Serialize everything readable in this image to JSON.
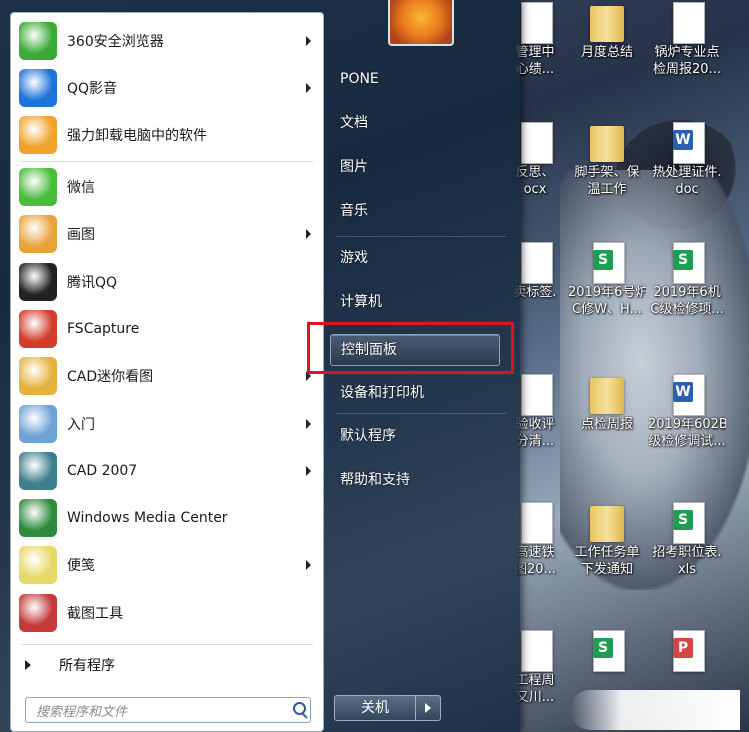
{
  "desktop": {
    "icons": [
      {
        "type": "doc",
        "badge": "",
        "line1": "管理中",
        "line2": "心绩..."
      },
      {
        "type": "folder",
        "badge": "",
        "line1": "月度总结",
        "line2": ""
      },
      {
        "type": "doc",
        "badge": "",
        "line1": "锅炉专业点",
        "line2": "检周报20..."
      },
      {
        "type": "doc",
        "badge": "",
        "line1": "反思、",
        "line2": "ocx"
      },
      {
        "type": "folder",
        "badge": "",
        "line1": "脚手架、保",
        "line2": "温工作"
      },
      {
        "type": "doc",
        "badge": "W",
        "line1": "热处理证件.",
        "line2": "doc"
      },
      {
        "type": "doc",
        "badge": "",
        "line1": "卖标签.",
        "line2": ""
      },
      {
        "type": "doc",
        "badge": "S",
        "line1": "2019年6号炉",
        "line2": "C修W、H..."
      },
      {
        "type": "doc",
        "badge": "S",
        "line1": "2019年6机",
        "line2": "C级检修项..."
      },
      {
        "type": "doc",
        "badge": "",
        "line1": "验收评",
        "line2": "分清..."
      },
      {
        "type": "folder",
        "badge": "",
        "line1": "点检周报",
        "line2": ""
      },
      {
        "type": "doc",
        "badge": "W",
        "line1": "2019年602B",
        "line2": "级检修调试..."
      },
      {
        "type": "doc",
        "badge": "",
        "line1": "高速铁",
        "line2": "图20..."
      },
      {
        "type": "folder",
        "badge": "",
        "line1": "工作任务单",
        "line2": "下发通知"
      },
      {
        "type": "doc",
        "badge": "S",
        "line1": "招考职位表.",
        "line2": "xls"
      },
      {
        "type": "doc",
        "badge": "",
        "line1": "工程周",
        "line2": "又川..."
      },
      {
        "type": "doc",
        "badge": "S",
        "line1": "",
        "line2": ""
      },
      {
        "type": "doc",
        "badge": "P",
        "line1": "",
        "line2": ""
      }
    ]
  },
  "start_menu": {
    "pinned": [
      {
        "name": "360安全浏览器",
        "icon": "360-browser-icon",
        "arrow": true
      },
      {
        "name": "QQ影音",
        "icon": "qq-player-icon",
        "arrow": true
      },
      {
        "name": "强力卸载电脑中的软件",
        "icon": "uninstaller-icon",
        "arrow": false
      }
    ],
    "recent": [
      {
        "name": "微信",
        "icon": "wechat-icon",
        "arrow": false
      },
      {
        "name": "画图",
        "icon": "paint-icon",
        "arrow": true
      },
      {
        "name": "腾讯QQ",
        "icon": "qq-penguin-icon",
        "arrow": false
      },
      {
        "name": "FSCapture",
        "icon": "fscapture-icon",
        "arrow": false
      },
      {
        "name": "CAD迷你看图",
        "icon": "cad-viewer-icon",
        "arrow": true
      },
      {
        "name": "入门",
        "icon": "getting-started-icon",
        "arrow": true
      },
      {
        "name": "CAD 2007",
        "icon": "autocad-icon",
        "arrow": true
      },
      {
        "name": "Windows Media Center",
        "icon": "media-center-icon",
        "arrow": false
      },
      {
        "name": "便笺",
        "icon": "sticky-notes-icon",
        "arrow": true
      },
      {
        "name": "截图工具",
        "icon": "snipping-tool-icon",
        "arrow": false
      }
    ],
    "all_programs": "所有程序",
    "search_placeholder": "搜索程序和文件",
    "right_items": [
      {
        "label": "PONE"
      },
      {
        "label": "文档"
      },
      {
        "label": "图片"
      },
      {
        "label": "音乐"
      },
      {
        "label": "游戏"
      },
      {
        "label": "计算机"
      },
      {
        "label": "控制面板"
      },
      {
        "label": "设备和打印机"
      },
      {
        "label": "默认程序"
      },
      {
        "label": "帮助和支持"
      }
    ],
    "highlighted_item": "控制面板",
    "shutdown_label": "关机",
    "highlight_color": "#e0121b"
  }
}
